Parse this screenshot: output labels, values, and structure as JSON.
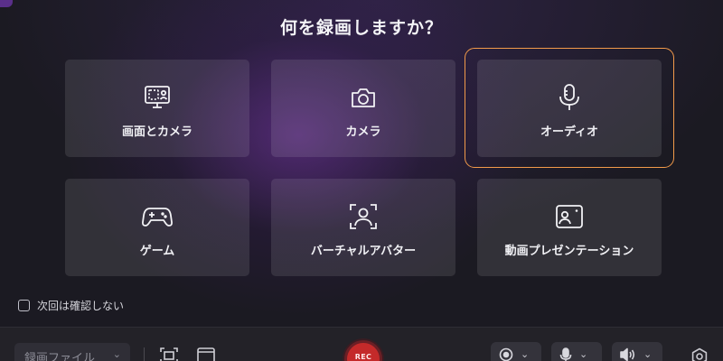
{
  "title": "何を録画しますか？",
  "cards": [
    {
      "label": "画面とカメラ",
      "icon": "screen-camera-icon"
    },
    {
      "label": "カメラ",
      "icon": "camera-icon"
    },
    {
      "label": "オーディオ",
      "icon": "microphone-icon",
      "selected": true
    },
    {
      "label": "ゲーム",
      "icon": "gamepad-icon"
    },
    {
      "label": "バーチャルアバター",
      "icon": "avatar-icon"
    },
    {
      "label": "動画プレゼンテーション",
      "icon": "presentation-icon"
    }
  ],
  "checkbox": {
    "label": "次回は確認しない",
    "checked": false
  },
  "bottom_bar": {
    "save_select": {
      "value": "録画ファイル"
    },
    "rec_label": "REC"
  },
  "colors": {
    "accent_ring": "#f29a4a",
    "rec_red": "#c42a2a",
    "purple_glow": "#7834aa"
  }
}
